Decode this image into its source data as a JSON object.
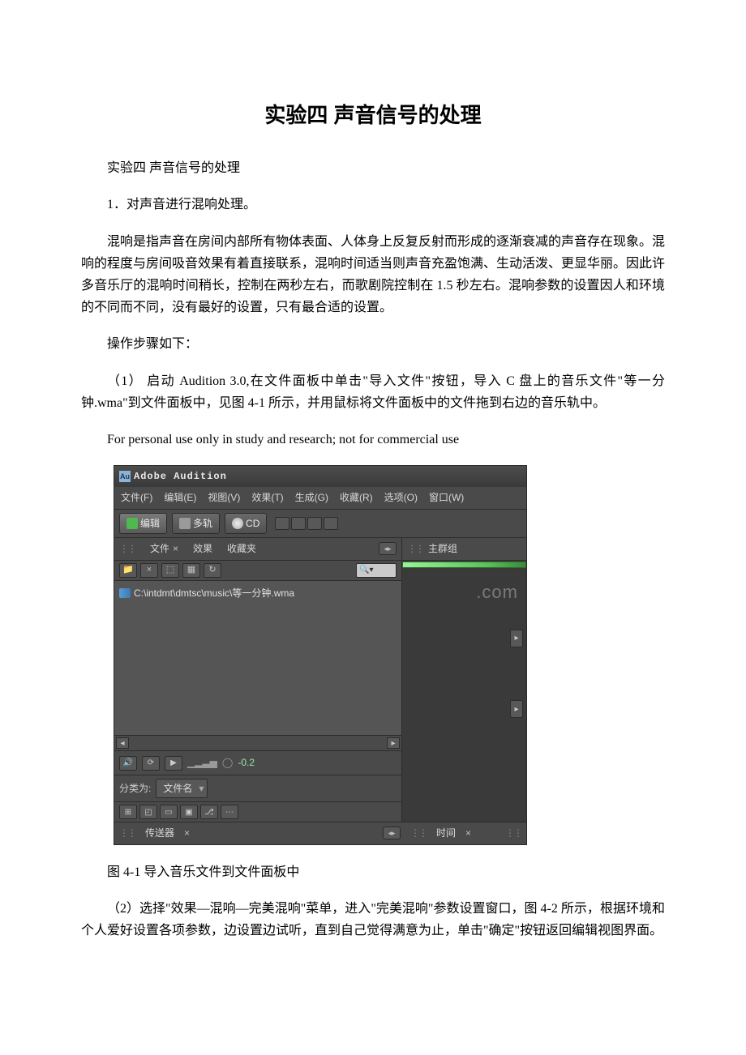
{
  "doc": {
    "title": "实验四 声音信号的处理",
    "subtitle": "实验四 声音信号的处理",
    "section1": "1．对声音进行混响处理。",
    "para_intro": "混响是指声音在房间内部所有物体表面、人体身上反复反射而形成的逐渐衰减的声音存在现象。混响的程度与房间吸音效果有着直接联系，混响时间适当则声音充盈饱满、生动活泼、更显华丽。因此许多音乐厅的混响时间稍长，控制在两秒左右，而歌剧院控制在 1.5 秒左右。混响参数的设置因人和环境的不同而不同，没有最好的设置，只有最合适的设置。",
    "steps_label": "操作步骤如下：",
    "step1": "（1） 启动 Audition 3.0,在文件面板中单击\"导入文件\"按钮，导入 C 盘上的音乐文件\"等一分钟.wma\"到文件面板中，见图 4-1 所示，并用鼠标将文件面板中的文件拖到右边的音乐轨中。",
    "english_note": "For personal use only in study and research; not for commercial use",
    "fig_caption": "图 4-1 导入音乐文件到文件面板中",
    "step2": "（2）选择\"效果—混响—完美混响\"菜单，进入\"完美混响\"参数设置窗口，图 4-2 所示，根据环境和个人爱好设置各项参数，边设置边试听，直到自己觉得满意为止，单击\"确定\"按钮返回编辑视图界面。"
  },
  "app": {
    "title": "Adobe Audition",
    "menu": {
      "file": "文件(F)",
      "edit": "编辑(E)",
      "view": "视图(V)",
      "effect": "效果(T)",
      "generate": "生成(G)",
      "favorite": "收藏(R)",
      "option": "选项(O)",
      "window": "窗口(W)"
    },
    "toolbar": {
      "btn_edit": "编辑",
      "btn_multi": "多轨",
      "btn_cd": "CD"
    },
    "tabs": {
      "file": "文件",
      "effect": "效果",
      "favorite": "收藏夹"
    },
    "file_entry": "C:\\intdmt\\dmtsc\\music\\等一分钟.wma",
    "ctrl_value": "-0.2",
    "sort_label": "分类为:",
    "sort_value": "文件名",
    "track_label": "主群组",
    "bottom": {
      "transport": "传送器",
      "time": "时间"
    },
    "watermark": ".com"
  }
}
